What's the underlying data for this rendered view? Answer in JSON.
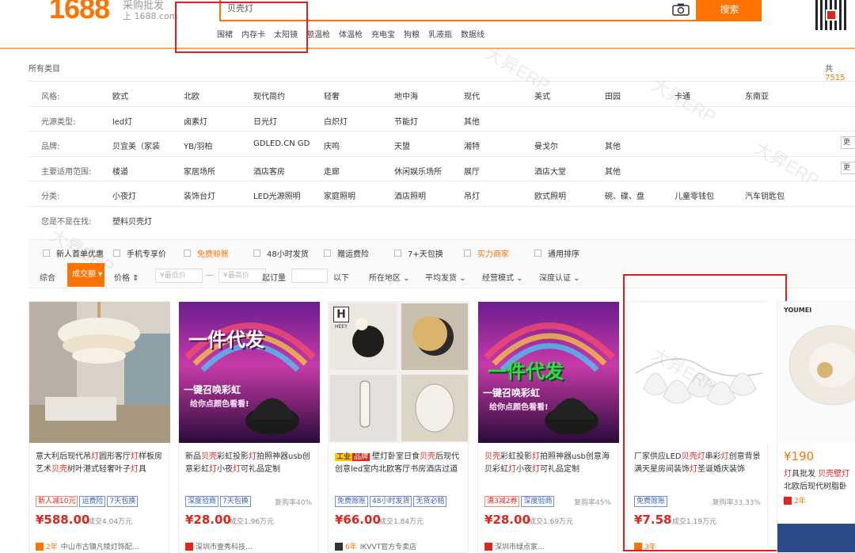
{
  "header": {
    "logo": "1688",
    "logo_sub": "采购批发",
    "logo_domain": "上 1688.com",
    "search_value": "贝壳灯",
    "search_button": "搜索",
    "hot_words": [
      "围裙",
      "内存卡",
      "太阳镜",
      "额温枪",
      "体温枪",
      "充电宝",
      "狗粮",
      "乳液瓶",
      "数据线"
    ]
  },
  "all_categories": "所有类目",
  "total": {
    "prefix": "共",
    "count": "7515"
  },
  "filters": [
    {
      "label": "风格:",
      "options": [
        "欧式",
        "北欧",
        "现代简约",
        "轻奢",
        "地中海",
        "现代",
        "美式",
        "田园",
        "卡通",
        "东南亚"
      ],
      "more": ""
    },
    {
      "label": "光源类型:",
      "options": [
        "led灯",
        "卤素灯",
        "日光灯",
        "白炽灯",
        "节能灯",
        "其他"
      ],
      "more": ""
    },
    {
      "label": "品牌:",
      "options": [
        "贝宜美（家装",
        "YB/羽柏",
        "GDLED.CN GD",
        "庆鸣",
        "天盟",
        "湘特",
        "曼戈尔",
        "其他"
      ],
      "more": "更多"
    },
    {
      "label": "主要适用范围:",
      "options": [
        "楼道",
        "家居场所",
        "酒店客房",
        "走廊",
        "休闲娱乐场所",
        "展厅",
        "酒店大堂",
        "其他"
      ],
      "more": "更多"
    },
    {
      "label": "分类:",
      "options": [
        "小夜灯",
        "装饰台灯",
        "LED光源照明",
        "家庭照明",
        "酒店照明",
        "吊灯",
        "欧式照明",
        "碗、碟、盘",
        "儿童零钱包",
        "汽车钥匙包"
      ],
      "more": ""
    },
    {
      "label": "您是不是在找:",
      "options": [
        "塑料贝壳灯"
      ],
      "more": ""
    }
  ],
  "checks": [
    "新人首单优惠",
    "手机专享价",
    "免费赊账",
    "48小时发货",
    "赠运费险",
    "7+天包换",
    "实力商家",
    "通用排序"
  ],
  "sortbar": {
    "default": "综合",
    "active": "成交额",
    "price": "价格",
    "min_price": "¥最低价",
    "dash": "—",
    "max_price": "¥最高价",
    "start_qty": "起订量",
    "below": "以下",
    "location": "所在地区",
    "ship": "平均发货",
    "mode": "经营模式",
    "certify": "深度认证"
  },
  "products": [
    {
      "title_parts": [
        "意大利后现代吊",
        "灯",
        "圆形客厅",
        "灯",
        "样板房艺术",
        "贝壳",
        "树叶港式轻奢叶子",
        "灯",
        "具"
      ],
      "tags": [
        {
          "t": "新人减10元",
          "red": true
        },
        {
          "t": "运费险",
          "red": false
        },
        {
          "t": "7天包换",
          "red": false
        }
      ],
      "buy_rate": "",
      "price": "¥588.00",
      "sold": "成交4.04万元",
      "year": "2年",
      "shop": "中山市古镇凡犊灯饰配..."
    },
    {
      "title_parts": [
        "新品",
        "贝壳",
        "彩虹投影",
        "灯",
        "拍照神器usb创意彩虹",
        "灯",
        "小夜",
        "灯",
        "可礼品定制"
      ],
      "tags": [
        {
          "t": "深度验商",
          "red": false
        },
        {
          "t": "7天包换",
          "red": false
        }
      ],
      "buy_rate": "复购率40%",
      "price": "¥28.00",
      "sold": "成交1.96万元",
      "year": "",
      "shop": "深圳市壹秀科技..."
    },
    {
      "title_parts": [
        "",
        "",
        "壁灯卧室日食",
        "贝壳",
        "后现代创意led室内北欧客厅书房酒店过道",
        "灯",
        ""
      ],
      "tags": [
        {
          "t": "免费赊账",
          "red": false
        },
        {
          "t": "48小时发货",
          "red": false
        },
        {
          "t": "无货必赔",
          "red": false
        }
      ],
      "buy_rate": "",
      "price": "¥66.00",
      "sold": "成交1.84万元",
      "year": "6年",
      "shop": "IKVVT官方专卖店"
    },
    {
      "title_parts": [
        "贝壳",
        "彩虹投影",
        "灯",
        "拍照神器usb创意海贝彩虹",
        "灯",
        "小夜",
        "灯",
        "可礼品定制"
      ],
      "tags": [
        {
          "t": "满3减2券",
          "red": true
        },
        {
          "t": "深度验商",
          "red": false
        }
      ],
      "buy_rate": "复购率45%",
      "price": "¥28.00",
      "sold": "成交1.69万元",
      "year": "",
      "shop": "深圳市绿点家..."
    },
    {
      "title_parts": [
        "厂家供应LED",
        "贝壳",
        "灯",
        "串彩",
        "灯",
        "创意背景满天星房间装饰",
        "灯",
        "圣诞婚庆装饰"
      ],
      "tags": [
        {
          "t": "免费赊账",
          "red": false
        }
      ],
      "buy_rate": "复购率33.33%",
      "price": "¥7.58",
      "sold": "成交1.19万元",
      "year": "3年",
      "shop": ""
    },
    {
      "title_parts": [
        "灯",
        "具批发 ",
        "贝壳",
        "壁",
        "灯",
        "北欧后现代树脂卧",
        ""
      ],
      "tags": [],
      "buy_rate": "",
      "price": "¥190",
      "sold": "",
      "year": "2年",
      "shop": ""
    }
  ],
  "image_text": {
    "slogan": "一件代发",
    "sub1": "一键召唤彩虹",
    "sub2": "给你点颜色看看!",
    "brand_h": "H",
    "brand_name": "HEEY",
    "youmei": "YOUMEI",
    "badge1": "工业",
    "badge2": "品牌",
    "watermark": "大昇ERP"
  }
}
